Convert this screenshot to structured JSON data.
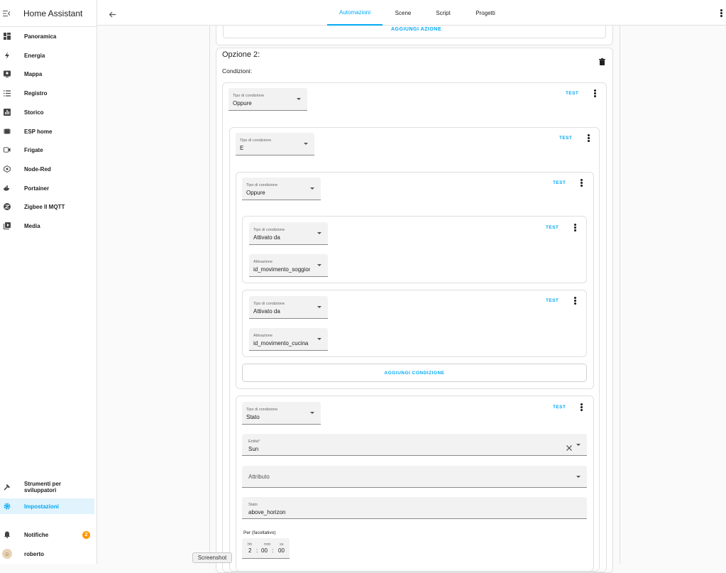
{
  "app": {
    "title": "Home Assistant"
  },
  "sidebar": {
    "items": [
      {
        "label": "Panoramica",
        "icon": "dashboard-icon"
      },
      {
        "label": "Energia",
        "icon": "lightning-icon"
      },
      {
        "label": "Mappa",
        "icon": "map-icon"
      },
      {
        "label": "Registro",
        "icon": "list-icon"
      },
      {
        "label": "Storico",
        "icon": "chart-icon"
      },
      {
        "label": "ESP home",
        "icon": "esphome-icon"
      },
      {
        "label": "Frigate",
        "icon": "cctv-icon"
      },
      {
        "label": "Node-Red",
        "icon": "nodered-icon"
      },
      {
        "label": "Portainer",
        "icon": "whale-icon"
      },
      {
        "label": "Zigbee ll MQTT",
        "icon": "zigbee-icon"
      },
      {
        "label": "Media",
        "icon": "media-icon"
      }
    ],
    "bottom": {
      "dev_tools": "Strumenti per sviluppatori",
      "settings": "Impostazioni",
      "notifications": "Notifiche",
      "notification_count": "2",
      "user": "roberto"
    }
  },
  "tabs": [
    {
      "label": "Automazioni"
    },
    {
      "label": "Scene"
    },
    {
      "label": "Script"
    },
    {
      "label": "Progetti"
    }
  ],
  "content": {
    "add_action": "AGGIUNGI AZIONE",
    "option_title": "Opzione 2:",
    "conditions_label": "Condizioni:",
    "test": "TEST",
    "add_condition": "AGGIUNGI CONDIZIONE",
    "cond_type_label": "Tipo di condizione",
    "activation_label": "Attivazione",
    "c1": {
      "value": "Oppure"
    },
    "c2": {
      "value": "E"
    },
    "c3": {
      "value": "Oppure"
    },
    "c4": {
      "type": "Attivato da",
      "activation": "id_movimento_soggiorno"
    },
    "c5": {
      "type": "Attivato da",
      "activation": "id_movimento_cucina"
    },
    "c6": {
      "type": "Stato",
      "entity_label": "Entità*",
      "entity": "Sun",
      "attribute_label": "Attributo",
      "state_label": "Stato",
      "state": "above_horizon",
      "for_label": "Per (facoltativo)",
      "hh_label": "hh",
      "mm_label": "mm",
      "ss_label": "ss",
      "hh": "2",
      "mm": "00",
      "ss": "00",
      "sep": ":"
    }
  },
  "screenshot_label": "Screenshot"
}
